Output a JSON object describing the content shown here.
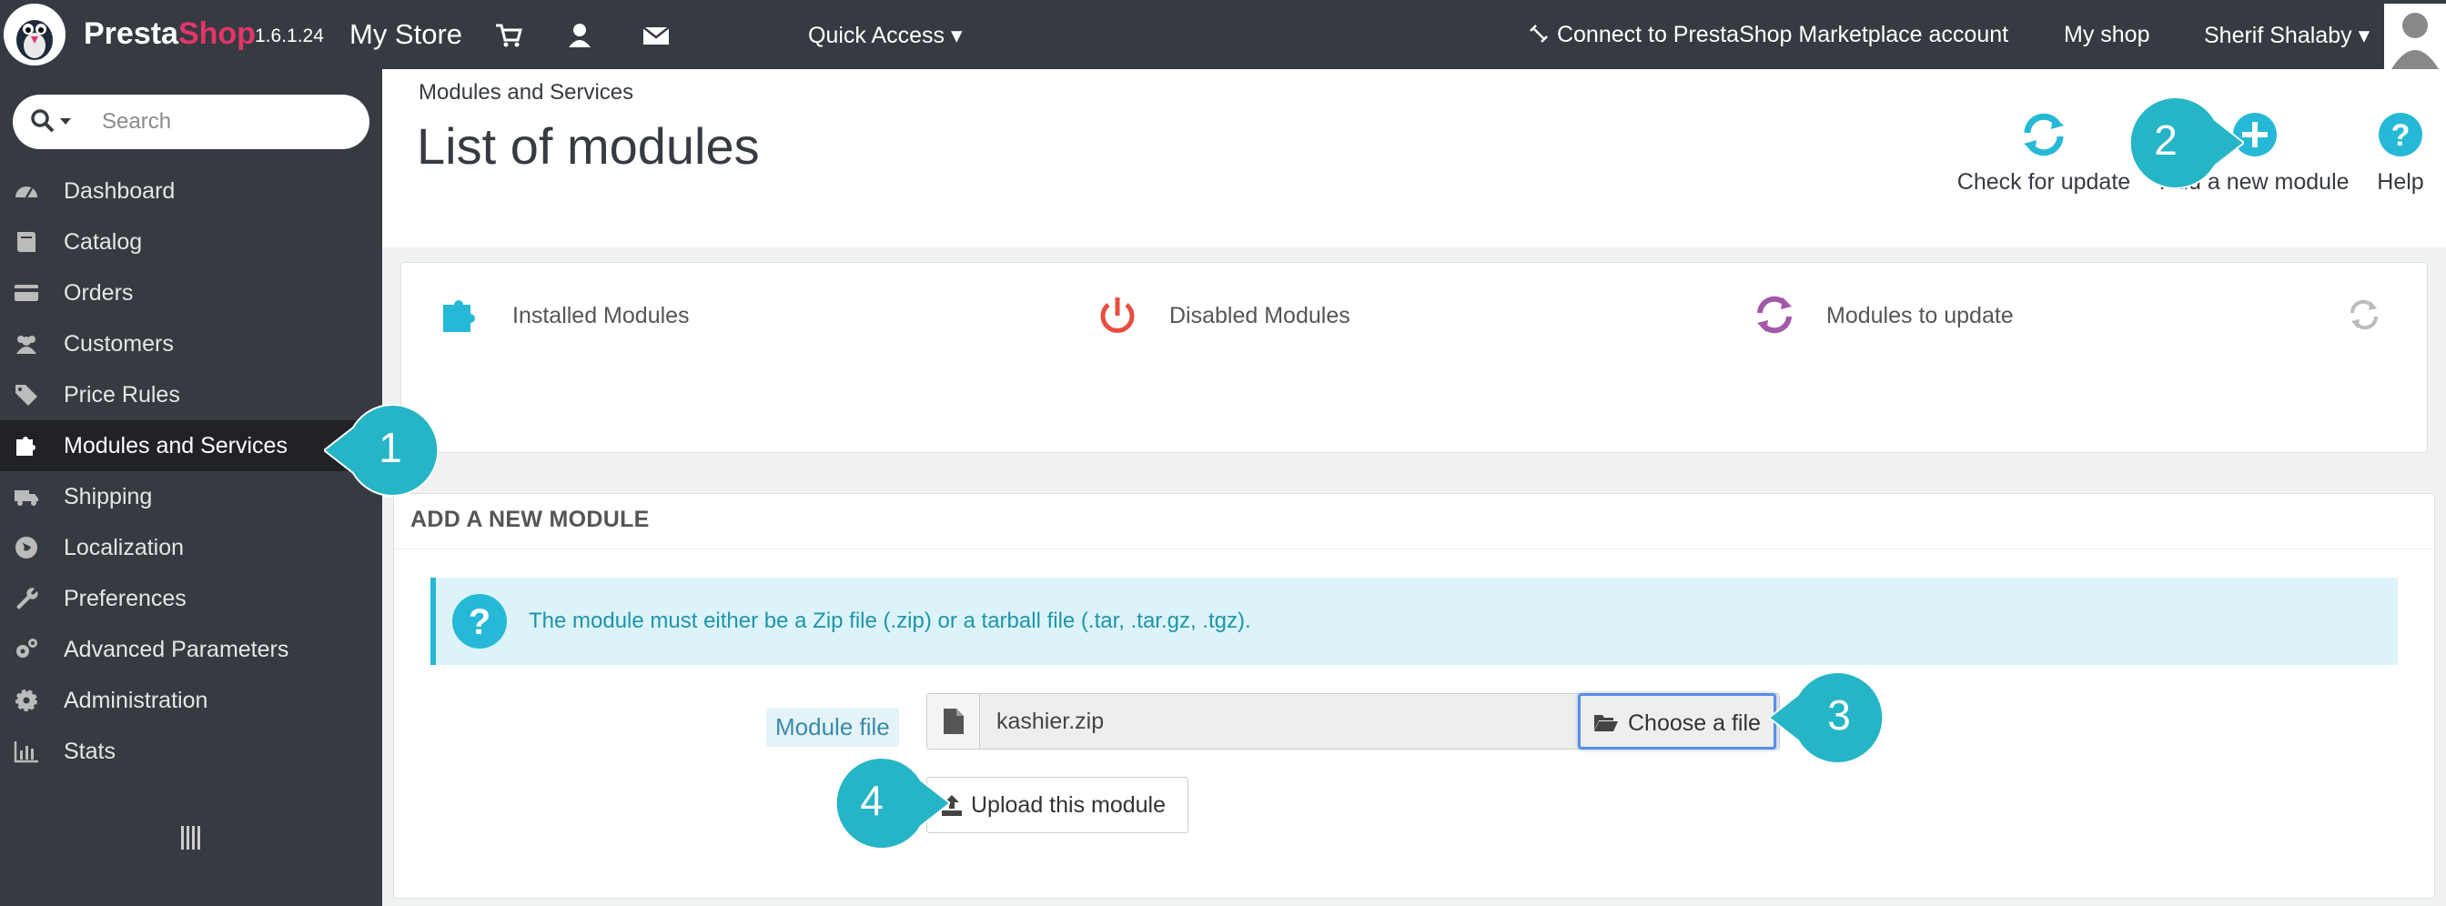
{
  "topbar": {
    "brand_presta": "Presta",
    "brand_shop": "Shop",
    "version": "1.6.1.24",
    "store_name": "My Store",
    "quick_access": "Quick Access",
    "connect_marketplace": "Connect to PrestaShop Marketplace account",
    "my_shop": "My shop",
    "user_name": "Sherif Shalaby"
  },
  "sidebar": {
    "search_placeholder": "Search",
    "items": [
      {
        "label": "Dashboard",
        "icon": "dashboard-icon"
      },
      {
        "label": "Catalog",
        "icon": "book-icon"
      },
      {
        "label": "Orders",
        "icon": "credit-card-icon"
      },
      {
        "label": "Customers",
        "icon": "users-icon"
      },
      {
        "label": "Price Rules",
        "icon": "tags-icon"
      },
      {
        "label": "Modules and Services",
        "icon": "puzzle-icon",
        "active": true
      },
      {
        "label": "Shipping",
        "icon": "truck-icon"
      },
      {
        "label": "Localization",
        "icon": "globe-icon"
      },
      {
        "label": "Preferences",
        "icon": "wrench-icon"
      },
      {
        "label": "Advanced Parameters",
        "icon": "cogs-icon"
      },
      {
        "label": "Administration",
        "icon": "cog-icon"
      },
      {
        "label": "Stats",
        "icon": "bar-chart-icon"
      }
    ]
  },
  "header": {
    "breadcrumb": "Modules and Services",
    "title": "List of modules",
    "toolbar": {
      "check_update": "Check for update",
      "add_module": "Add a new module",
      "help": "Help"
    }
  },
  "stats": {
    "installed": "Installed Modules",
    "disabled": "Disabled Modules",
    "to_update": "Modules to update"
  },
  "add_module": {
    "heading": "ADD A NEW MODULE",
    "info": "The module must either be a Zip file (.zip) or a tarball file (.tar, .tar.gz, .tgz).",
    "file_label": "Module file",
    "file_value": "kashier.zip",
    "choose_label": "Choose a file",
    "upload_label": "Upload this module"
  },
  "callouts": [
    "1",
    "2",
    "3",
    "4"
  ],
  "colors": {
    "topbar": "#363a41",
    "sidebar": "#363a41",
    "active_item": "#202226",
    "accent_teal": "#25b9d7",
    "callout": "#25b5c6",
    "brand_pink": "#e3356a"
  }
}
